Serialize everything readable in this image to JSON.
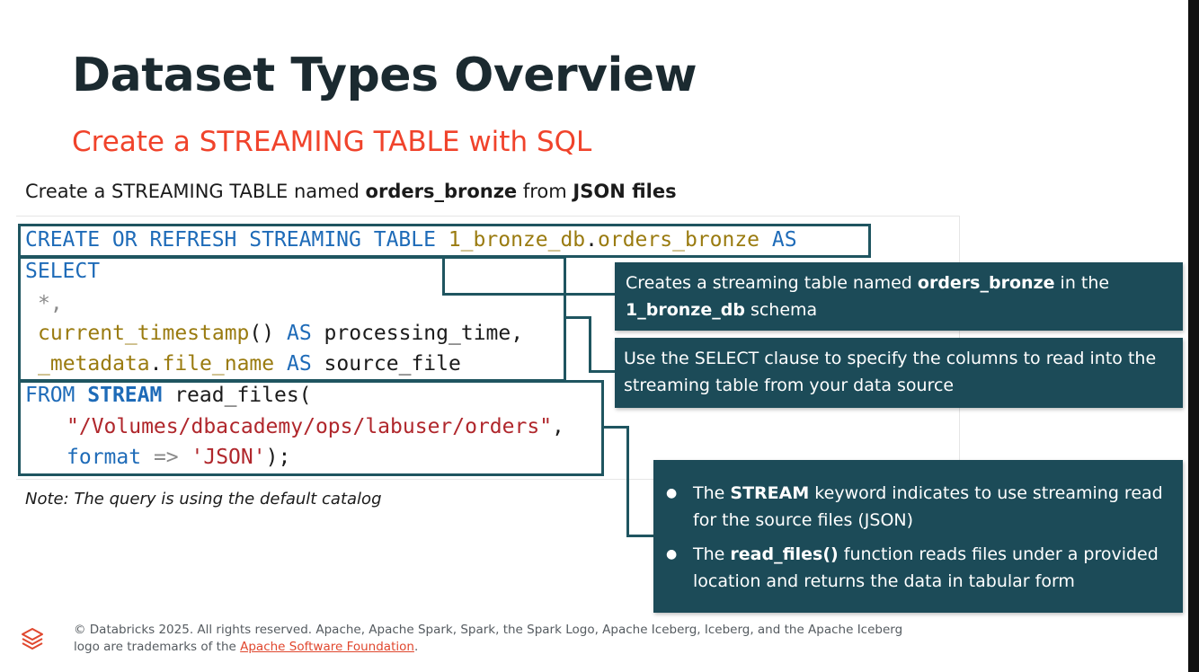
{
  "slide": {
    "title": "Dataset Types Overview",
    "subtitle": "Create a STREAMING TABLE with SQL",
    "intro": {
      "prefix": "Create a STREAMING TABLE named ",
      "table_name": "orders_bronze",
      "middle": " from ",
      "source": "JSON files"
    },
    "note": "Note: The query is using the default catalog"
  },
  "code": {
    "line1": {
      "kw": "CREATE OR REFRESH STREAMING TABLE",
      "schema": "1_bronze_db",
      "dot": ".",
      "table": "orders_bronze",
      "as": "AS"
    },
    "line2": {
      "kw": "SELECT"
    },
    "line3": {
      "text": "*,"
    },
    "line4": {
      "fn": "current_timestamp",
      "parens": "()",
      "as": "AS",
      "alias": "processing_time,"
    },
    "line5": {
      "meta": "_metadata",
      "dot": ".",
      "field": "file_name",
      "as": "AS",
      "alias": "source_file"
    },
    "line6": {
      "from": "FROM",
      "stream": "STREAM",
      "fn": "read_files("
    },
    "line7": {
      "path": "\"/Volumes/dbacademy/ops/labuser/orders\"",
      "comma": ","
    },
    "line8": {
      "param": "format",
      "arrow": "=>",
      "value": "'JSON'",
      "end": ");"
    }
  },
  "callouts": {
    "c1": {
      "a": "Creates a streaming table named ",
      "b": "orders_bronze",
      "c": " in the",
      "d": "1_bronze_db",
      "e": " schema"
    },
    "c2": {
      "text": "Use the SELECT clause to specify the columns to read into the streaming table from your data source"
    },
    "c3": {
      "b1": {
        "a": "The ",
        "b": "STREAM",
        "c": " keyword indicates to use streaming read for the source files (JSON)"
      },
      "b2": {
        "a": "The ",
        "b": "read_files()",
        "c": " function reads files under a provided location and returns the data in tabular form"
      }
    }
  },
  "footer": {
    "text": "© Databricks 2025. All rights reserved. Apache, Apache Spark, Spark, the Spark Logo, Apache Iceberg, Iceberg, and the Apache Iceberg logo are trademarks of the ",
    "link": "Apache Software Foundation",
    "end": "."
  },
  "colors": {
    "title": "#1b2a30",
    "accent": "#f0432b",
    "callout_bg": "#1c4b58",
    "keyword": "#1e6bb8",
    "function": "#9a7b10",
    "string": "#b0272c"
  }
}
